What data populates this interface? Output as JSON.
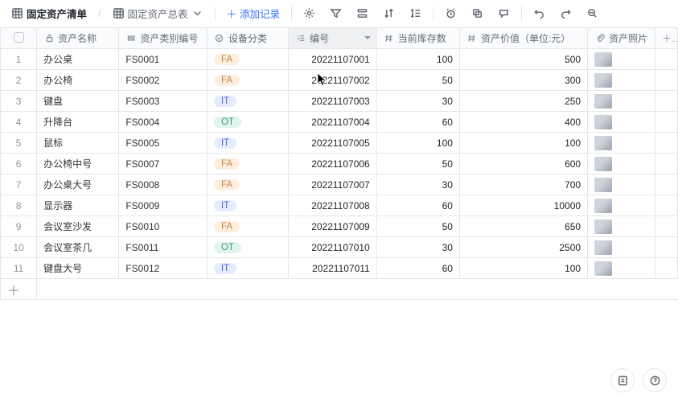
{
  "toolbar": {
    "list_title": "固定资产清单",
    "view_title": "固定资产总表",
    "add_label": "添加记录"
  },
  "columns": {
    "name": "资产名称",
    "cat": "资产类别编号",
    "type": "设备分类",
    "code": "编号",
    "stock": "当前库存数",
    "value": "资产价值（单位:元）",
    "photo": "资产照片"
  },
  "rows": [
    {
      "idx": "1",
      "name": "办公桌",
      "cat": "FS0001",
      "type": "FA",
      "code": "20221107001",
      "stock": "100",
      "value": "500"
    },
    {
      "idx": "2",
      "name": "办公椅",
      "cat": "FS0002",
      "type": "FA",
      "code": "20221107002",
      "stock": "50",
      "value": "300"
    },
    {
      "idx": "3",
      "name": "键盘",
      "cat": "FS0003",
      "type": "IT",
      "code": "20221107003",
      "stock": "30",
      "value": "250"
    },
    {
      "idx": "4",
      "name": "升降台",
      "cat": "FS0004",
      "type": "OT",
      "code": "20221107004",
      "stock": "60",
      "value": "400"
    },
    {
      "idx": "5",
      "name": "鼠标",
      "cat": "FS0005",
      "type": "IT",
      "code": "20221107005",
      "stock": "100",
      "value": "100"
    },
    {
      "idx": "6",
      "name": "办公椅中号",
      "cat": "FS0007",
      "type": "FA",
      "code": "20221107006",
      "stock": "50",
      "value": "600"
    },
    {
      "idx": "7",
      "name": "办公桌大号",
      "cat": "FS0008",
      "type": "FA",
      "code": "20221107007",
      "stock": "30",
      "value": "700"
    },
    {
      "idx": "8",
      "name": "显示器",
      "cat": "FS0009",
      "type": "IT",
      "code": "20221107008",
      "stock": "60",
      "value": "10000"
    },
    {
      "idx": "9",
      "name": "会议室沙发",
      "cat": "FS0010",
      "type": "FA",
      "code": "20221107009",
      "stock": "50",
      "value": "650"
    },
    {
      "idx": "10",
      "name": "会议室茶几",
      "cat": "FS0011",
      "type": "OT",
      "code": "20221107010",
      "stock": "30",
      "value": "2500"
    },
    {
      "idx": "11",
      "name": "键盘大号",
      "cat": "FS0012",
      "type": "IT",
      "code": "20221107011",
      "stock": "60",
      "value": "100"
    }
  ]
}
